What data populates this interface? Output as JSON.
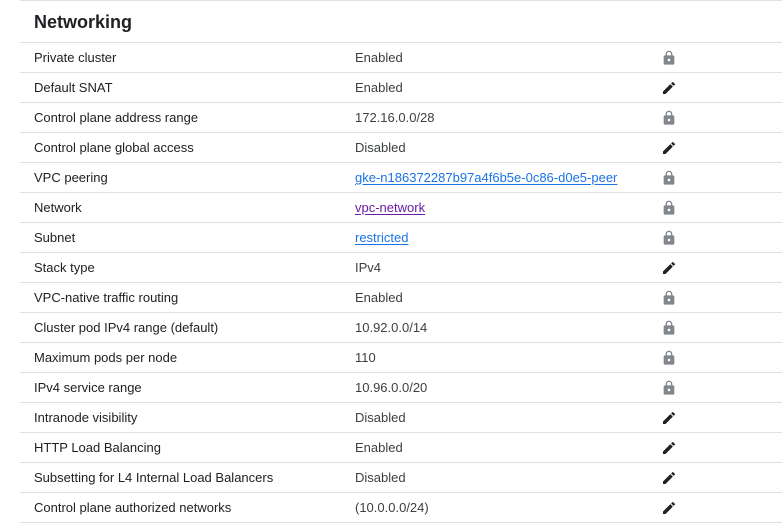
{
  "section": {
    "title": "Networking"
  },
  "rows": [
    {
      "label": "Private cluster",
      "value": "Enabled",
      "icon": "lock-icon"
    },
    {
      "label": "Default SNAT",
      "value": "Enabled",
      "icon": "edit-icon"
    },
    {
      "label": "Control plane address range",
      "value": "172.16.0.0/28",
      "icon": "lock-icon"
    },
    {
      "label": "Control plane global access",
      "value": "Disabled",
      "icon": "edit-icon"
    },
    {
      "label": "VPC peering",
      "value": "gke-n186372287b97a4f6b5e-0c86-d0e5-peer",
      "icon": "lock-icon",
      "link": true
    },
    {
      "label": "Network",
      "value": "vpc-network",
      "icon": "lock-icon",
      "link": true
    },
    {
      "label": "Subnet",
      "value": "restricted",
      "icon": "lock-icon",
      "link": true
    },
    {
      "label": "Stack type",
      "value": "IPv4",
      "icon": "edit-icon"
    },
    {
      "label": "VPC-native traffic routing",
      "value": "Enabled",
      "icon": "lock-icon"
    },
    {
      "label": "Cluster pod IPv4 range (default)",
      "value": "10.92.0.0/14",
      "icon": "lock-icon"
    },
    {
      "label": "Maximum pods per node",
      "value": "110",
      "icon": "lock-icon"
    },
    {
      "label": "IPv4 service range",
      "value": "10.96.0.0/20",
      "icon": "lock-icon"
    },
    {
      "label": "Intranode visibility",
      "value": "Disabled",
      "icon": "edit-icon"
    },
    {
      "label": "HTTP Load Balancing",
      "value": "Enabled",
      "icon": "edit-icon"
    },
    {
      "label": "Subsetting for L4 Internal Load Balancers",
      "value": "Disabled",
      "icon": "edit-icon"
    },
    {
      "label": "Control plane authorized networks",
      "value": "(10.0.0.0/24)",
      "icon": "edit-icon"
    }
  ],
  "colors": {
    "link": "#1a73e8",
    "link_visited": "#681da8",
    "lock_icon": "#80868b",
    "edit_icon": "#202124",
    "divider": "#e0e0e0"
  }
}
